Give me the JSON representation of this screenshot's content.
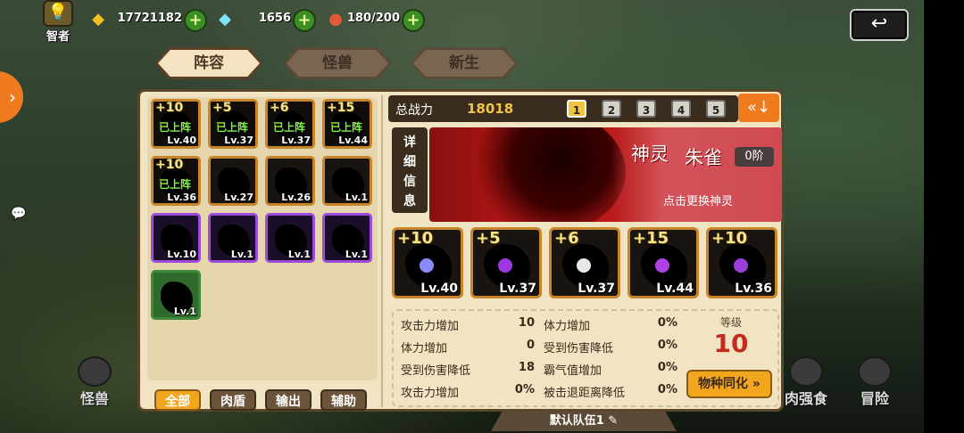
{
  "topbar": {
    "rank_label": "智者",
    "resources": [
      {
        "icon": "gold-ingot-icon",
        "value": "17721182"
      },
      {
        "icon": "diamond-icon",
        "value": "1656"
      },
      {
        "icon": "meat-icon",
        "value": "180/200"
      }
    ]
  },
  "tabs": [
    "阵容",
    "怪兽",
    "新生"
  ],
  "roster": {
    "cards": [
      {
        "bonus": "+10",
        "on_team": "已上阵",
        "level": "Lv.40",
        "color": "orange"
      },
      {
        "bonus": "+5",
        "on_team": "已上阵",
        "level": "Lv.37",
        "color": "orange"
      },
      {
        "bonus": "+6",
        "on_team": "已上阵",
        "level": "Lv.37",
        "color": "orange"
      },
      {
        "bonus": "+15",
        "on_team": "已上阵",
        "level": "Lv.44",
        "color": "orange"
      },
      {
        "bonus": "+10",
        "on_team": "已上阵",
        "level": "Lv.36",
        "color": "orange"
      },
      {
        "bonus": "",
        "on_team": "",
        "level": "Lv.27",
        "color": "orange"
      },
      {
        "bonus": "",
        "on_team": "",
        "level": "Lv.26",
        "color": "orange"
      },
      {
        "bonus": "",
        "on_team": "",
        "level": "Lv.1",
        "color": "orange"
      },
      {
        "bonus": "",
        "on_team": "",
        "level": "Lv.10",
        "color": "purple"
      },
      {
        "bonus": "",
        "on_team": "",
        "level": "Lv.1",
        "color": "purple"
      },
      {
        "bonus": "",
        "on_team": "",
        "level": "Lv.1",
        "color": "purple"
      },
      {
        "bonus": "",
        "on_team": "",
        "level": "Lv.1",
        "color": "purple"
      },
      {
        "bonus": "",
        "on_team": "",
        "level": "Lv.1",
        "color": "green"
      }
    ],
    "filters": [
      "全部",
      "肉盾",
      "输出",
      "辅助"
    ]
  },
  "power": {
    "label": "总战力",
    "value": "18018",
    "slots": [
      "1",
      "2",
      "3",
      "4",
      "5"
    ],
    "active_slot": "1"
  },
  "detail": {
    "label_lines": [
      "详",
      "细",
      "信",
      "息"
    ],
    "spirit_type": "神灵",
    "spirit_name": "朱雀",
    "spirit_rank": "0阶",
    "hint": "点击更换神灵"
  },
  "team": [
    {
      "bonus": "+10",
      "level": "Lv.40"
    },
    {
      "bonus": "+5",
      "level": "Lv.37"
    },
    {
      "bonus": "+6",
      "level": "Lv.37"
    },
    {
      "bonus": "+15",
      "level": "Lv.44"
    },
    {
      "bonus": "+10",
      "level": "Lv.36"
    }
  ],
  "stats": {
    "left": [
      {
        "name": "攻击力增加",
        "value": "10"
      },
      {
        "name": "体力增加",
        "value": "0"
      },
      {
        "name": "受到伤害降低",
        "value": "18"
      },
      {
        "name": "攻击力增加",
        "value": "0%"
      }
    ],
    "right": [
      {
        "name": "体力增加",
        "value": "0%"
      },
      {
        "name": "受到伤害降低",
        "value": "0%"
      },
      {
        "name": "霸气值增加",
        "value": "0%"
      },
      {
        "name": "被击退距离降低",
        "value": "0%"
      }
    ]
  },
  "level": {
    "label": "等级",
    "value": "10"
  },
  "species_button": "物种同化",
  "team_name": "默认队伍1",
  "nav": [
    "怪兽",
    "肉强食",
    "冒险"
  ]
}
